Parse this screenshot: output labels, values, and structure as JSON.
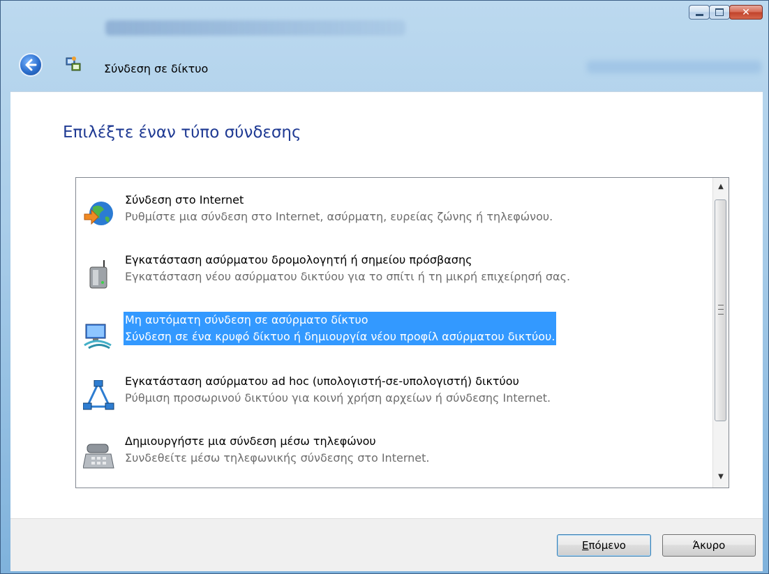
{
  "window": {
    "nav_title": "Σύνδεση σε δίκτυο"
  },
  "main": {
    "heading": "Επιλέξτε έναν τύπο σύνδεσης",
    "options": [
      {
        "label": "Σύνδεση στο Internet",
        "description": "Ρυθμίστε μια σύνδεση στο Internet, ασύρματη, ευρείας ζώνης ή τηλεφώνου.",
        "icon": "globe-internet-icon",
        "selected": false
      },
      {
        "label": "Εγκατάσταση ασύρματου δρομολογητή ή σημείου πρόσβασης",
        "description": "Εγκατάσταση νέου ασύρματου δικτύου για το σπίτι ή τη μικρή επιχείρησή σας.",
        "icon": "wireless-router-icon",
        "selected": false
      },
      {
        "label": "Μη αυτόματη σύνδεση σε ασύρματο δίκτυο",
        "description": "Σύνδεση σε ένα κρυφό δίκτυο ή δημιουργία νέου προφίλ ασύρματου δικτύου.",
        "icon": "wireless-network-icon",
        "selected": true
      },
      {
        "label": "Εγκατάσταση ασύρματου ad hoc (υπολογιστή-σε-υπολογιστή) δικτύου",
        "description": "Ρύθμιση προσωρινού δικτύου για κοινή χρήση αρχείων ή σύνδεσης Internet.",
        "icon": "adhoc-network-icon",
        "selected": false
      },
      {
        "label": "Δημιουργήστε μια σύνδεση μέσω τηλεφώνου",
        "description": "Συνδεθείτε μέσω τηλεφωνικής σύνδεσης στο Internet.",
        "icon": "dialup-phone-icon",
        "selected": false
      }
    ]
  },
  "footer": {
    "next_mnemonic": "Ε",
    "next_rest": "πόμενο",
    "cancel_label": "Άκυρο"
  },
  "colors": {
    "selection": "#3399ff",
    "heading": "#1f3a93"
  }
}
